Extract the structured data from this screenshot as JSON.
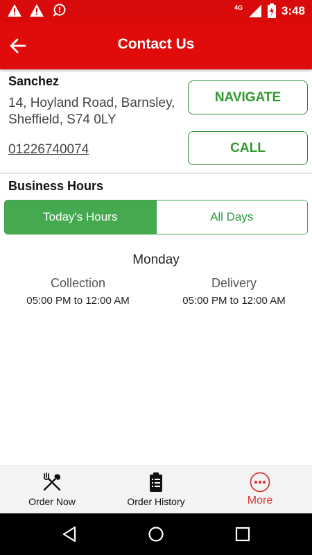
{
  "status_bar": {
    "time": "3:48",
    "network": "4G",
    "icons": [
      "warning-icon",
      "warning-icon",
      "alert-chat-icon",
      "signal-icon",
      "battery-charging-icon"
    ]
  },
  "app_bar": {
    "title": "Contact Us",
    "back_icon": "arrow-left-icon"
  },
  "store": {
    "name": "Sanchez",
    "address_line1": "14, Hoyland Road, Barnsley,",
    "address_line2": "Sheffield, S74 0LY",
    "phone": "01226740074"
  },
  "actions": {
    "navigate_label": "NAVIGATE",
    "call_label": "CALL"
  },
  "hours": {
    "heading": "Business Hours",
    "tabs": [
      {
        "label": "Today's Hours",
        "active": true
      },
      {
        "label": "All Days",
        "active": false
      }
    ],
    "day": "Monday",
    "collection_label": "Collection",
    "collection_time": "05:00 PM to 12:00 AM",
    "delivery_label": "Delivery",
    "delivery_time": "05:00 PM to 12:00 AM"
  },
  "bottom_nav": {
    "items": [
      {
        "label": "Order Now",
        "icon": "fork-knife-icon",
        "active": false
      },
      {
        "label": "Order History",
        "icon": "clipboard-icon",
        "active": false
      },
      {
        "label": "More",
        "icon": "more-dots-icon",
        "active": true
      }
    ]
  },
  "colors": {
    "brand_red": "#e00b0b",
    "green": "#45a94f",
    "active_nav": "#d83a3a"
  }
}
